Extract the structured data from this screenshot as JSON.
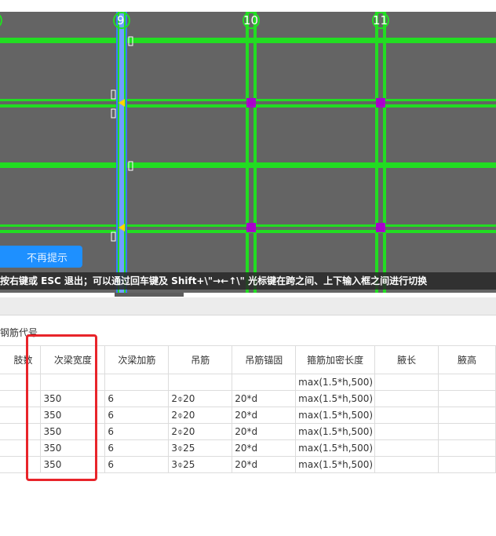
{
  "canvas": {
    "axis_labels": [
      "9",
      "10",
      "11"
    ],
    "colors": {
      "background": "#646464",
      "beam": "#22dd22",
      "selected_beam": "#3a7bff",
      "node": "#aa00cc",
      "marker": "#ffd400"
    }
  },
  "tip_button": {
    "label": "不再提示"
  },
  "hint_bar": {
    "text": "按右键或 ESC 退出；可以通过回车键及 Shift+\\\"→←↑\\\" 光标键在跨之间、上下输入框之间进行切换"
  },
  "section_title": "钢筋代号",
  "table": {
    "headers": [
      "肢数",
      "次梁宽度",
      "次梁加筋",
      "吊筋",
      "吊筋锚固",
      "箍筋加密长度",
      "腋长",
      "腋高"
    ],
    "rows": [
      [
        "",
        "",
        "",
        "",
        "",
        "max(1.5*h,500)",
        "",
        ""
      ],
      [
        "",
        "350",
        "6",
        "2⌽20",
        "20*d",
        "max(1.5*h,500)",
        "",
        ""
      ],
      [
        "",
        "350",
        "6",
        "2⌽20",
        "20*d",
        "max(1.5*h,500)",
        "",
        ""
      ],
      [
        "",
        "350",
        "6",
        "2⌽20",
        "20*d",
        "max(1.5*h,500)",
        "",
        ""
      ],
      [
        "",
        "350",
        "6",
        "3⌽25",
        "20*d",
        "max(1.5*h,500)",
        "",
        ""
      ],
      [
        "",
        "350",
        "6",
        "3⌽25",
        "20*d",
        "max(1.5*h,500)",
        "",
        ""
      ]
    ]
  }
}
